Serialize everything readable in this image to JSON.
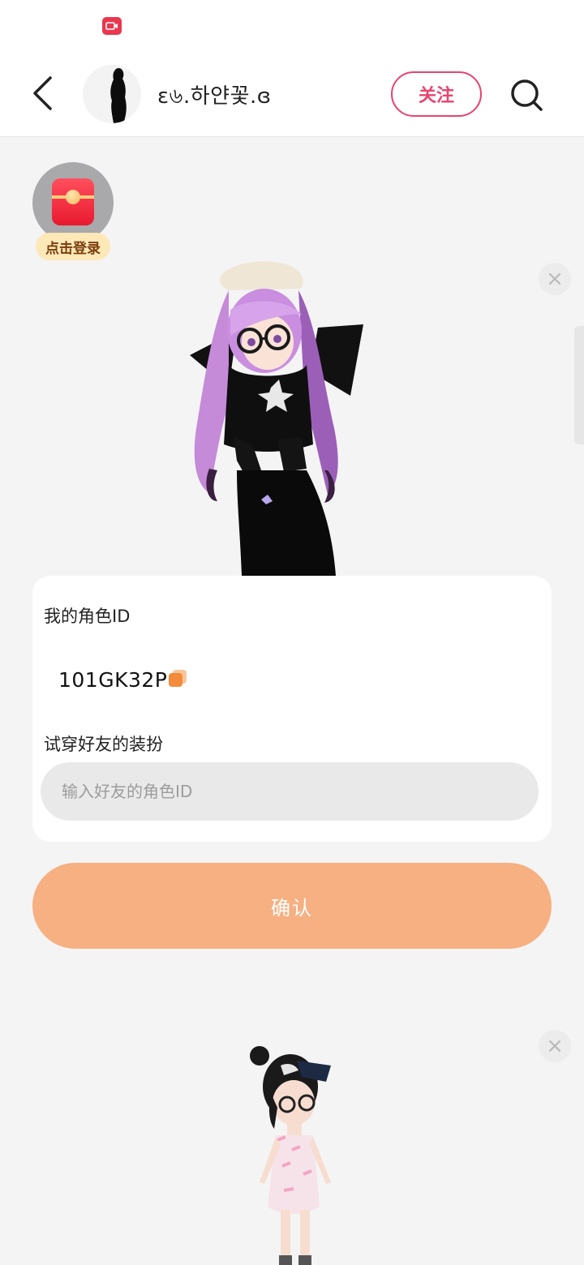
{
  "status_bar": {
    "indicator_icon": "screen-record-icon",
    "indicator_color": "#e8384f"
  },
  "header": {
    "back_icon": "chevron-left-icon",
    "username": "ɛ৬.하얀꽃.ɞ",
    "follow_label": "关注",
    "search_icon": "search-icon",
    "accent_color": "#e8436e"
  },
  "redpack": {
    "icon": "red-envelope-icon",
    "login_label": "点击登录"
  },
  "card": {
    "my_id_label": "我的角色ID",
    "my_id_value": "101GK32P",
    "copy_icon": "copy-icon",
    "try_on_label": "试穿好友的装扮",
    "friend_input_placeholder": "输入好友的角色ID",
    "friend_input_value": ""
  },
  "confirm_label": "确认",
  "confirm_color": "#f7b082"
}
